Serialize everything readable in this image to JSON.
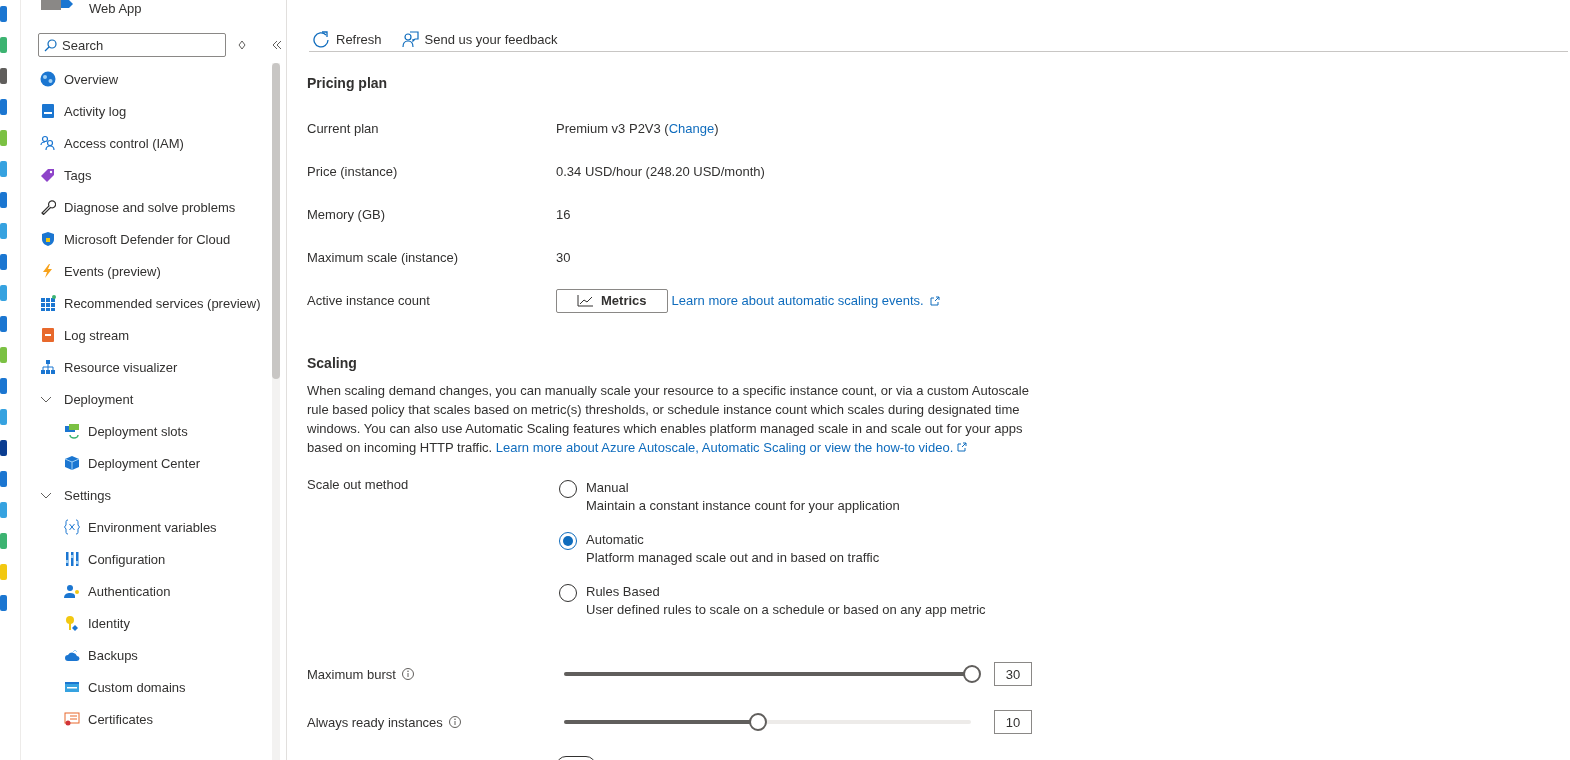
{
  "header": {
    "title": "Web App"
  },
  "sidebar": {
    "search": {
      "placeholder": "Search"
    },
    "items": [
      {
        "kind": "item",
        "label": "Overview"
      },
      {
        "kind": "item",
        "label": "Activity log"
      },
      {
        "kind": "item",
        "label": "Access control (IAM)"
      },
      {
        "kind": "item",
        "label": "Tags"
      },
      {
        "kind": "item",
        "label": "Diagnose and solve problems"
      },
      {
        "kind": "item",
        "label": "Microsoft Defender for Cloud"
      },
      {
        "kind": "item",
        "label": "Events (preview)"
      },
      {
        "kind": "item",
        "label": "Recommended services (preview)"
      },
      {
        "kind": "item",
        "label": "Log stream"
      },
      {
        "kind": "item",
        "label": "Resource visualizer"
      },
      {
        "kind": "group",
        "label": "Deployment",
        "expanded": true,
        "children": [
          {
            "kind": "item",
            "label": "Deployment slots"
          },
          {
            "kind": "item",
            "label": "Deployment Center"
          }
        ]
      },
      {
        "kind": "group",
        "label": "Settings",
        "expanded": true,
        "children": [
          {
            "kind": "item",
            "label": "Environment variables"
          },
          {
            "kind": "item",
            "label": "Configuration"
          },
          {
            "kind": "item",
            "label": "Authentication"
          },
          {
            "kind": "item",
            "label": "Identity"
          },
          {
            "kind": "item",
            "label": "Backups"
          },
          {
            "kind": "item",
            "label": "Custom domains"
          },
          {
            "kind": "item",
            "label": "Certificates"
          }
        ]
      }
    ]
  },
  "toolbar": [
    {
      "label": "Refresh"
    },
    {
      "label": "Send us your feedback"
    }
  ],
  "pricing": {
    "title": "Pricing plan",
    "rows": [
      {
        "kind": "text",
        "label": "Current plan",
        "value": "Premium v3 P2V3 (",
        "link": "Change",
        "suffix": ")"
      },
      {
        "kind": "text",
        "label": "Price (instance)",
        "value": "0.34 USD/hour (248.20 USD/month)"
      },
      {
        "kind": "text",
        "label": "Memory (GB)",
        "value": "16"
      },
      {
        "kind": "text",
        "label": "Maximum scale (instance)",
        "value": "30"
      },
      {
        "kind": "action",
        "label": "Active instance count",
        "button": "Metrics",
        "link": "Learn more about automatic scaling events."
      }
    ]
  },
  "scaling": {
    "title": "Scaling",
    "description": "When scaling demand changes, you can manually scale your resource to a specific instance count, or via a custom Autoscale rule based policy that scales based on metric(s) thresholds, or schedule instance count which scales during designated time windows. You can also use Automatic Scaling features which enables platform managed scale in and scale out for your apps based on incoming HTTP traffic.",
    "description_link": "Learn more about Azure Autoscale, Automatic Scaling or view the how-to video.",
    "method_label": "Scale out method",
    "options": [
      {
        "label": "Manual",
        "description": "Maintain a constant instance count for your application",
        "selected": false
      },
      {
        "label": "Automatic",
        "description": "Platform managed scale out and in based on traffic",
        "selected": true
      },
      {
        "label": "Rules Based",
        "description": "User defined rules to scale on a schedule or based on any app metric",
        "selected": false
      }
    ],
    "sliders": [
      {
        "label": "Maximum burst",
        "level": 1.0,
        "value": "30"
      },
      {
        "label": "Always ready instances",
        "level": 0.475,
        "value": "10"
      }
    ],
    "toggle": {
      "on": false
    }
  }
}
